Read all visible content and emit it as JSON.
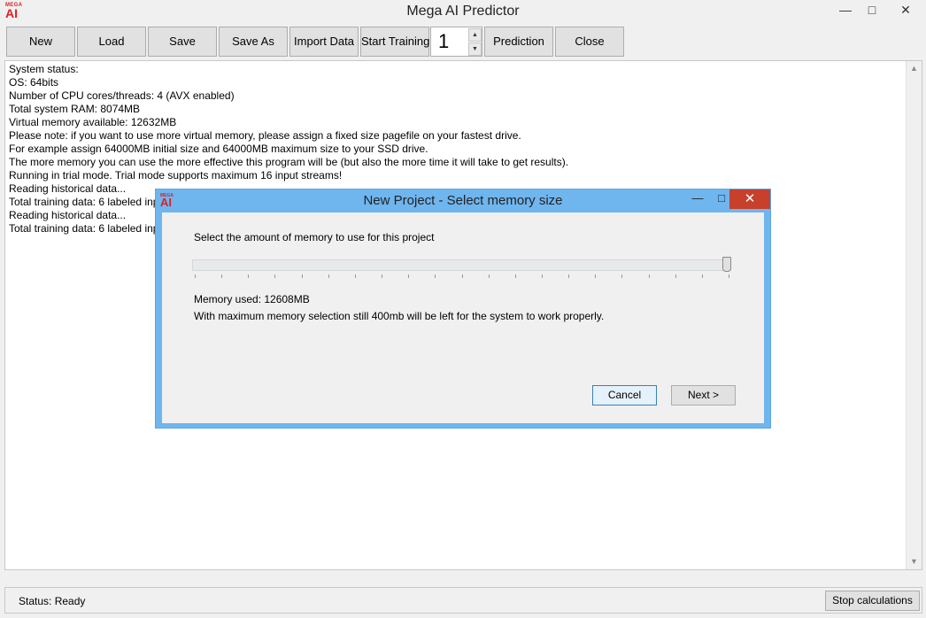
{
  "window": {
    "title": "Mega AI Predictor",
    "logo_small": "MEGA",
    "logo_big": "AI",
    "minimize_icon": "minimize-icon",
    "maximize_icon": "maximize-icon",
    "close_icon": "close-icon"
  },
  "toolbar": {
    "new_label": "New",
    "load_label": "Load",
    "save_label": "Save",
    "save_as_label": "Save As",
    "import_label": "Import Data",
    "start_training_label": "Start Training",
    "spinner_value": "1",
    "prediction_label": "Prediction",
    "close_label": "Close"
  },
  "log": {
    "lines": [
      "System status:",
      "OS: 64bits",
      "Number of CPU cores/threads: 4  (AVX enabled)",
      "Total system RAM: 8074MB",
      "Virtual memory available: 12632MB",
      "Please note: if you want to use more virtual memory, please assign a fixed size pagefile on your fastest drive.",
      "For example assign 64000MB initial size and 64000MB maximum size to your SSD drive.",
      "The more memory you can use the more effective this program will be (but also the more time it will take to get results).",
      "Running in trial mode. Trial mode supports maximum 16 input streams!",
      "Reading historical data...",
      "Total training data: 6 labeled inputs",
      "Reading historical data...",
      "Total training data: 6 labeled inputs"
    ]
  },
  "statusbar": {
    "status_text": "Status: Ready",
    "stop_label": "Stop calculations"
  },
  "dialog": {
    "title": "New Project - Select memory size",
    "logo_small": "MEGA",
    "logo_big": "AI",
    "prompt": "Select the amount of memory to use for this project",
    "slider_value_fraction": 1.0,
    "memory_used": "Memory used: 12608MB",
    "note": "With maximum memory selection still 400mb will be left for the system to work properly.",
    "cancel_label": "Cancel",
    "next_label": "Next >",
    "close_color": "#c7402b",
    "titlebar_color": "#6fb5ee"
  }
}
